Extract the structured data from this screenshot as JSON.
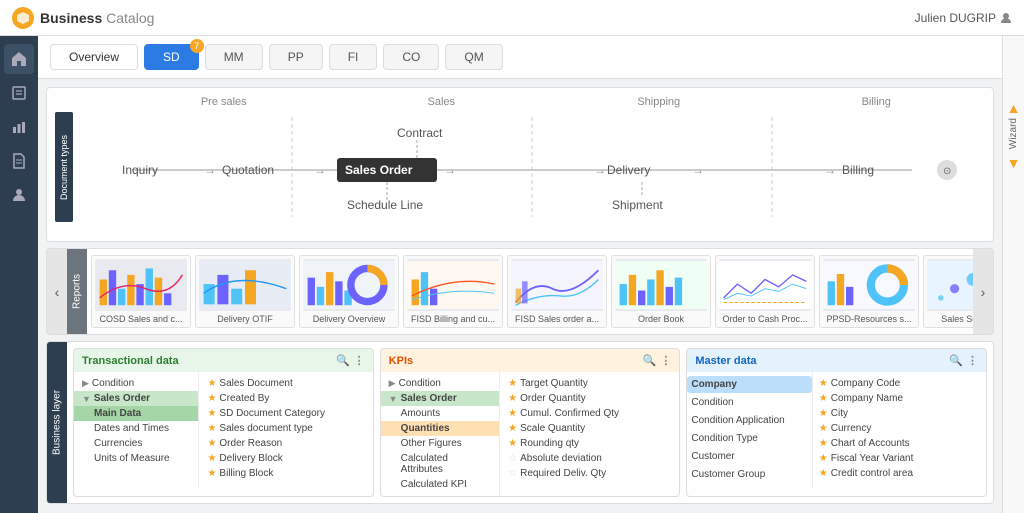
{
  "app": {
    "logo": "Business Catalog",
    "logo_business": "Business",
    "logo_catalog": "Catalog",
    "user": "Julien DUGRIP"
  },
  "sidebar": {
    "icons": [
      "home",
      "book",
      "chart-bar",
      "document",
      "user"
    ]
  },
  "wizard": {
    "label": "Wizard",
    "arrow_up": "▲",
    "arrow_down": "▼"
  },
  "tabs": [
    {
      "label": "Overview",
      "active": false,
      "badge": null
    },
    {
      "label": "SD",
      "active": true,
      "badge": "7"
    },
    {
      "label": "MM",
      "active": false,
      "badge": null
    },
    {
      "label": "PP",
      "active": false,
      "badge": null
    },
    {
      "label": "FI",
      "active": false,
      "badge": null
    },
    {
      "label": "CO",
      "active": false,
      "badge": null
    },
    {
      "label": "QM",
      "active": false,
      "badge": null
    }
  ],
  "diagram": {
    "business_layer_label": "Document types",
    "phases": [
      "Pre sales",
      "Sales",
      "Shipping",
      "Billing"
    ],
    "nodes": [
      {
        "label": "Inquiry",
        "x": 8,
        "type": "normal"
      },
      {
        "label": "Quotation",
        "x": 18,
        "type": "normal"
      },
      {
        "label": "Contract",
        "x": 30,
        "type": "above"
      },
      {
        "label": "Sales Order",
        "x": 38,
        "type": "highlight"
      },
      {
        "label": "Schedule Line",
        "x": 38,
        "type": "below"
      },
      {
        "label": "Delivery",
        "x": 62,
        "type": "normal"
      },
      {
        "label": "Shipment",
        "x": 62,
        "type": "below"
      },
      {
        "label": "Billing",
        "x": 86,
        "type": "normal"
      }
    ]
  },
  "reports": {
    "label": "Reports",
    "items": [
      {
        "title": "COSD Sales and c...",
        "colors": [
          "#f5a623",
          "#6c63ff",
          "#4fc3f7"
        ]
      },
      {
        "title": "Delivery OTIF",
        "colors": [
          "#4fc3f7",
          "#6c63ff",
          "#f5a623"
        ]
      },
      {
        "title": "Delivery Overview",
        "colors": [
          "#6c63ff",
          "#4fc3f7",
          "#f5a623"
        ]
      },
      {
        "title": "FISD Billing and cu...",
        "colors": [
          "#f5a623",
          "#4fc3f7",
          "#6c63ff"
        ]
      },
      {
        "title": "FISD Sales order a...",
        "colors": [
          "#4fc3f7",
          "#6c63ff",
          "#f5a623"
        ]
      },
      {
        "title": "Order Book",
        "colors": [
          "#f5a623",
          "#6c63ff",
          "#4fc3f7"
        ]
      },
      {
        "title": "Order to Cash Proc...",
        "colors": [
          "#6c63ff",
          "#f5a623",
          "#4fc3f7"
        ]
      },
      {
        "title": "PPSD-Resources s...",
        "colors": [
          "#4fc3f7",
          "#f5a623",
          "#6c63ff"
        ]
      },
      {
        "title": "Sales Summary",
        "colors": [
          "#6c63ff",
          "#4fc3f7",
          "#f5a623"
        ]
      }
    ]
  },
  "business_layer": {
    "label": "Business layer",
    "panels": {
      "transactional": {
        "header": "Transactional data",
        "color_accent": "#2e7d32",
        "left_items": [
          {
            "label": "Condition",
            "arrow": true,
            "selected": false
          },
          {
            "label": "Sales Order",
            "arrow": true,
            "selected": true
          },
          {
            "label": "Main Data",
            "indent": true,
            "sub_selected": true
          },
          {
            "label": "Dates and Times",
            "indent": true,
            "selected": false
          },
          {
            "label": "Currencies",
            "indent": true,
            "selected": false
          },
          {
            "label": "Units of Measure",
            "indent": true,
            "selected": false
          }
        ],
        "right_items": [
          {
            "label": "Sales Document",
            "star": true
          },
          {
            "label": "Created By",
            "star": true
          },
          {
            "label": "SD Document Category",
            "star": true
          },
          {
            "label": "Sales document type",
            "star": true
          },
          {
            "label": "Order Reason",
            "star": true
          },
          {
            "label": "Delivery Block",
            "star": true
          },
          {
            "label": "Billing Block",
            "star": true
          }
        ]
      },
      "kpis": {
        "header": "KPIs",
        "color_accent": "#e65100",
        "left_items": [
          {
            "label": "Condition",
            "arrow": true,
            "selected": false
          },
          {
            "label": "Sales Order",
            "arrow": true,
            "selected": true
          },
          {
            "label": "Amounts",
            "indent": true,
            "selected": false
          },
          {
            "label": "Quantities",
            "indent": true,
            "highlighted": true
          },
          {
            "label": "Other Figures",
            "indent": true,
            "selected": false
          },
          {
            "label": "Calculated Attributes",
            "indent": true,
            "selected": false
          },
          {
            "label": "Calculated KPI",
            "indent": true,
            "selected": false
          }
        ],
        "right_items": [
          {
            "label": "Target Quantity",
            "star": true
          },
          {
            "label": "Order Quantity",
            "star": true
          },
          {
            "label": "Cumul. Confirmed Qty",
            "star": true
          },
          {
            "label": "Scale Quantity",
            "star": true
          },
          {
            "label": "Rounding qty",
            "star": true
          },
          {
            "label": "Absolute deviation",
            "star": false
          },
          {
            "label": "Required Deliv. Qty",
            "star": false
          }
        ]
      },
      "master": {
        "header": "Master data",
        "color_accent": "#1565c0",
        "left_items": [
          {
            "label": "Company",
            "selected": true
          },
          {
            "label": "Condition",
            "selected": false
          },
          {
            "label": "Condition Application",
            "selected": false
          },
          {
            "label": "Condition Type",
            "selected": false
          },
          {
            "label": "Customer",
            "selected": false
          },
          {
            "label": "Customer Group",
            "selected": false
          }
        ],
        "right_items": [
          {
            "label": "Company Code",
            "star": true
          },
          {
            "label": "Company Name",
            "star": true
          },
          {
            "label": "City",
            "star": true
          },
          {
            "label": "Currency",
            "star": true
          },
          {
            "label": "Chart of Accounts",
            "star": true
          },
          {
            "label": "Fiscal Year Variant",
            "star": true
          },
          {
            "label": "Credit control area",
            "star": true
          }
        ]
      }
    }
  }
}
